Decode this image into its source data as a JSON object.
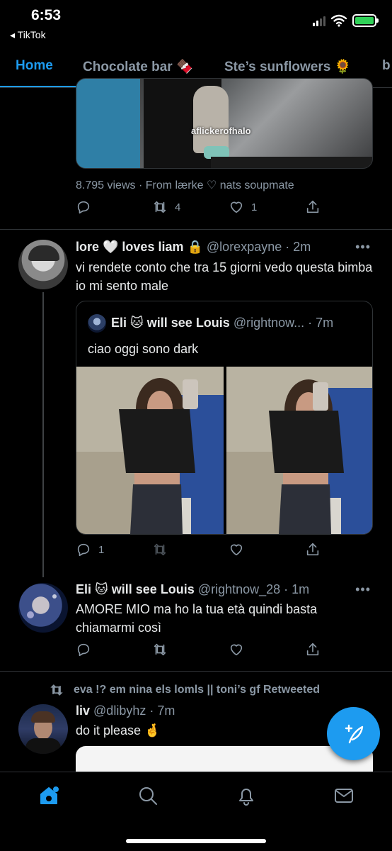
{
  "status_bar": {
    "time": "6:53",
    "back_app": "◂ TikTok",
    "battery_color": "#30d158"
  },
  "tabs": [
    {
      "label": "Home",
      "active": true
    },
    {
      "label": "Chocolate bar 🍫",
      "active": false
    },
    {
      "label": "Ste’s sunflowers 🌻",
      "active": false
    },
    {
      "label": "b",
      "active": false
    }
  ],
  "top_tweet": {
    "watermark": "aflickerofhalo",
    "meta": "8.795 views · From lærke ♡ nats soupmate",
    "retweets": "4",
    "likes": "1"
  },
  "tweet1": {
    "name": "lore 🤍 loves liam 🔒",
    "handle": "@lorexpayne · 2m",
    "more": "•••",
    "text": "vi rendete conto che tra 15 giorni vedo questa bimba io mi sento male",
    "quote": {
      "name": "Eli 🐱 will see Louis",
      "handle": "@rightnow... · 7m",
      "text": "ciao oggi sono dark"
    },
    "replies": "1"
  },
  "tweet2": {
    "name": "Eli 🐱 will see Louis",
    "handle": "@rightnow_28 · 1m",
    "more": "•••",
    "text": "AMORE MIO ma ho la tua età quindi basta chiamarmi così"
  },
  "tweet3": {
    "retweet_label": "eva !? em nina els lomls || toni’s gf Retweeted",
    "name": "liv",
    "handle": "@dlibyhz · 7m",
    "text": "do it please 🤞"
  },
  "colors": {
    "accent": "#1d9bf0",
    "background": "#000000",
    "secondary_text": "#8b98a5",
    "divider": "#2f3336"
  },
  "icons": {
    "reply": "reply-icon",
    "retweet": "retweet-icon",
    "like": "heart-icon",
    "share": "share-icon",
    "compose": "compose-feather-icon",
    "home": "home-icon",
    "search": "search-icon",
    "notifications": "bell-icon",
    "messages": "mail-icon"
  }
}
